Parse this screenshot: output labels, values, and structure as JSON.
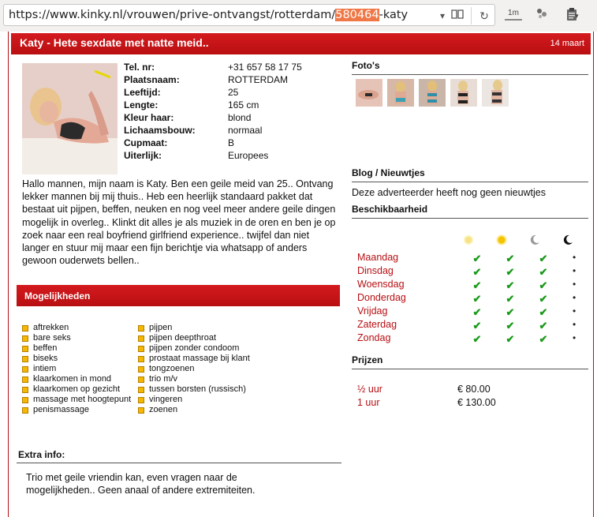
{
  "browser": {
    "url_prefix": "https://www.kinky.nl/vrouwen/prive-ontvangst/rotterdam/",
    "url_selected": "580464",
    "url_suffix": "-katy",
    "toolbar_1m": "1m",
    "icons": [
      "dropdown-icon",
      "reader-view-icon",
      "reload-icon",
      "1m-icon",
      "extension-icon",
      "clipboard-icon"
    ]
  },
  "header": {
    "title": "Katy - Hete sexdate met natte meid..",
    "date": "14 maart"
  },
  "profile": {
    "rows": [
      {
        "label": "Tel. nr:",
        "value": "+31 657 58 17 75"
      },
      {
        "label": "Plaatsnaam:",
        "value": "ROTTERDAM"
      },
      {
        "label": "Leeftijd:",
        "value": "25"
      },
      {
        "label": "Lengte:",
        "value": "165 cm"
      },
      {
        "label": "Kleur haar:",
        "value": "blond"
      },
      {
        "label": "Lichaamsbouw:",
        "value": "normaal"
      },
      {
        "label": "Cupmaat:",
        "value": "B"
      },
      {
        "label": "Uiterlijk:",
        "value": "Europees"
      }
    ],
    "description": "Hallo mannen, mijn naam is Katy. Ben een geile meid van 25.. Ontvang lekker mannen bij mij thuis.. Heb een heerlijk standaard pakket dat bestaat uit pijpen, beffen, neuken en nog veel meer andere geile dingen mogelijk in overleg.. Klinkt dit alles je als muziek in de oren en ben je op zoek naar een real boyfriend girlfriend experience.. twijfel dan niet langer en stuur mij maar een fijn berichtje via whatsapp of anders gewoon ouderwets bellen.."
  },
  "possibilities": {
    "title": "Mogelijkheden",
    "col1": [
      "aftrekken",
      "bare seks",
      "beffen",
      "biseks",
      "intiem",
      "klaarkomen in mond",
      "klaarkomen op gezicht",
      "massage met hoogtepunt",
      "penismassage"
    ],
    "col2": [
      "pijpen",
      "pijpen deepthroat",
      "pijpen zonder condoom",
      "prostaat massage bij klant",
      "tongzoenen",
      "trio m/v",
      "tussen borsten (russisch)",
      "vingeren",
      "zoenen"
    ]
  },
  "extra": {
    "title": "Extra info:",
    "text": "Trio met geile vriendin kan, even vragen naar de mogelijkheden.. Geen anaal of andere extremiteiten."
  },
  "photos": {
    "title": "Foto's",
    "count": 5
  },
  "blog": {
    "title": "Blog / Nieuwtjes",
    "text": "Deze adverteerder heeft nog geen nieuwtjes"
  },
  "availability": {
    "title": "Beschikbaarheid",
    "columns": [
      "morning-icon",
      "afternoon-icon",
      "evening-icon",
      "night-icon"
    ],
    "days": [
      {
        "day": "Maandag",
        "slots": [
          true,
          true,
          true,
          false
        ]
      },
      {
        "day": "Dinsdag",
        "slots": [
          true,
          true,
          true,
          false
        ]
      },
      {
        "day": "Woensdag",
        "slots": [
          true,
          true,
          true,
          false
        ]
      },
      {
        "day": "Donderdag",
        "slots": [
          true,
          true,
          true,
          false
        ]
      },
      {
        "day": "Vrijdag",
        "slots": [
          true,
          true,
          true,
          false
        ]
      },
      {
        "day": "Zaterdag",
        "slots": [
          true,
          true,
          true,
          false
        ]
      },
      {
        "day": "Zondag",
        "slots": [
          true,
          true,
          true,
          false
        ]
      }
    ],
    "check_glyph": "✔",
    "dot_glyph": "•"
  },
  "prices": {
    "title": "Prijzen",
    "rows": [
      {
        "duration": "½  uur",
        "price": "€ 80.00"
      },
      {
        "duration": "1   uur",
        "price": "€ 130.00"
      }
    ]
  },
  "colors": {
    "brand_red": "#b70f13",
    "check_green": "#1a9a1a",
    "bullet_yellow": "#f5b800",
    "url_highlight": "#f07746"
  }
}
